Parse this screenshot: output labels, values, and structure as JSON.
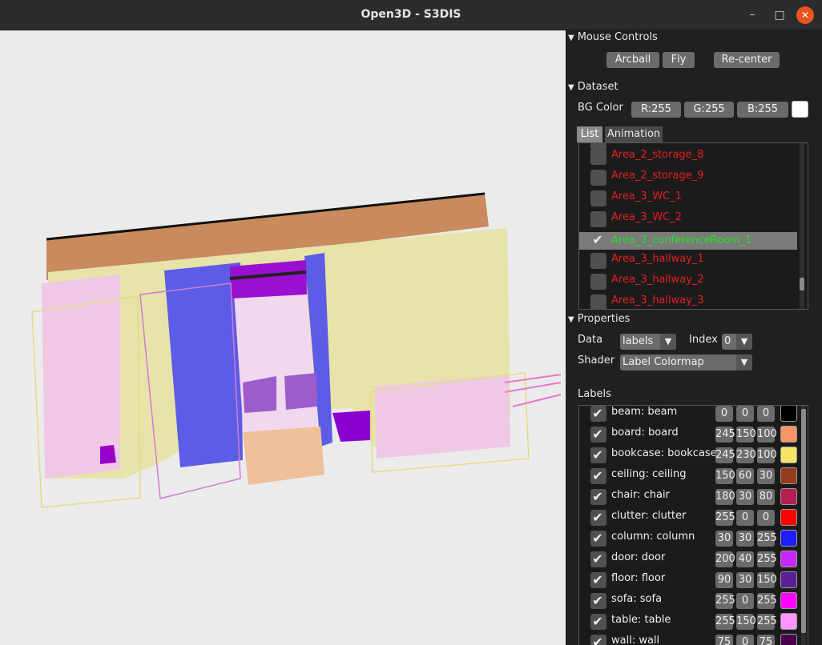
{
  "window": {
    "title": "Open3D - S3DIS",
    "minimize_glyph": "–",
    "maximize_glyph": "□",
    "close_glyph": "✕"
  },
  "icons": {
    "minimize": "minimize-icon",
    "maximize": "maximize-icon",
    "close": "close-icon",
    "expand": "triangle-down-icon",
    "check": "checkmark-icon",
    "dropdown": "chevron-down-icon"
  },
  "glyphs": {
    "triangle": "▼",
    "check": "✔",
    "arrow": "▼"
  },
  "colors": {
    "accent_close": "#e95420",
    "panel_bg": "#202020",
    "button_bg": "#6b6b6b",
    "unselected_text": "#e62020",
    "selected_text": "#24e024",
    "bg_color_swatch": "#ffffff",
    "viewport_bg": "#ebebeb"
  },
  "mouse_controls": {
    "title": "Mouse Controls",
    "buttons": [
      "Arcball",
      "Fly",
      "Re-center"
    ]
  },
  "dataset": {
    "title": "Dataset",
    "bg_color_label": "BG Color",
    "bg_r": "R:255",
    "bg_g": "G:255",
    "bg_b": "B:255",
    "tabs": [
      "List",
      "Animation"
    ],
    "active_tab": "List",
    "items": [
      {
        "name": "Area_2_storage_8",
        "checked": false
      },
      {
        "name": "Area_2_storage_9",
        "checked": false
      },
      {
        "name": "Area_3_WC_1",
        "checked": false
      },
      {
        "name": "Area_3_WC_2",
        "checked": false
      },
      {
        "name": "Area_3_conferenceRoom_1",
        "checked": true
      },
      {
        "name": "Area_3_hallway_1",
        "checked": false
      },
      {
        "name": "Area_3_hallway_2",
        "checked": false
      },
      {
        "name": "Area_3_hallway_3",
        "checked": false
      }
    ]
  },
  "properties": {
    "title": "Properties",
    "data_label": "Data",
    "data_value": "labels",
    "index_label": "Index",
    "index_value": "0",
    "shader_label": "Shader",
    "shader_value": "Label Colormap"
  },
  "labels": {
    "title": "Labels",
    "rows": [
      {
        "name": "beam: beam",
        "r": "0",
        "g": "0",
        "b": "0",
        "color": "#000000",
        "checked": true
      },
      {
        "name": "board: board",
        "r": "245",
        "g": "150",
        "b": "100",
        "color": "#f59664",
        "checked": true
      },
      {
        "name": "bookcase: bookcase",
        "r": "245",
        "g": "230",
        "b": "100",
        "color": "#f5e664",
        "checked": true
      },
      {
        "name": "ceiling: ceiling",
        "r": "150",
        "g": "60",
        "b": "30",
        "color": "#963c1e",
        "checked": true
      },
      {
        "name": "chair: chair",
        "r": "180",
        "g": "30",
        "b": "80",
        "color": "#b41e50",
        "checked": true
      },
      {
        "name": "clutter: clutter",
        "r": "255",
        "g": "0",
        "b": "0",
        "color": "#ff0000",
        "checked": true
      },
      {
        "name": "column: column",
        "r": "30",
        "g": "30",
        "b": "255",
        "color": "#1e1eff",
        "checked": true
      },
      {
        "name": "door: door",
        "r": "200",
        "g": "40",
        "b": "255",
        "color": "#c828ff",
        "checked": true
      },
      {
        "name": "floor: floor",
        "r": "90",
        "g": "30",
        "b": "150",
        "color": "#5a1e96",
        "checked": true
      },
      {
        "name": "sofa: sofa",
        "r": "255",
        "g": "0",
        "b": "255",
        "color": "#ff00ff",
        "checked": true
      },
      {
        "name": "table: table",
        "r": "255",
        "g": "150",
        "b": "255",
        "color": "#ff96ff",
        "checked": true
      },
      {
        "name": "wall: wall",
        "r": "75",
        "g": "0",
        "b": "75",
        "color": "#4b004b",
        "checked": true
      }
    ]
  }
}
